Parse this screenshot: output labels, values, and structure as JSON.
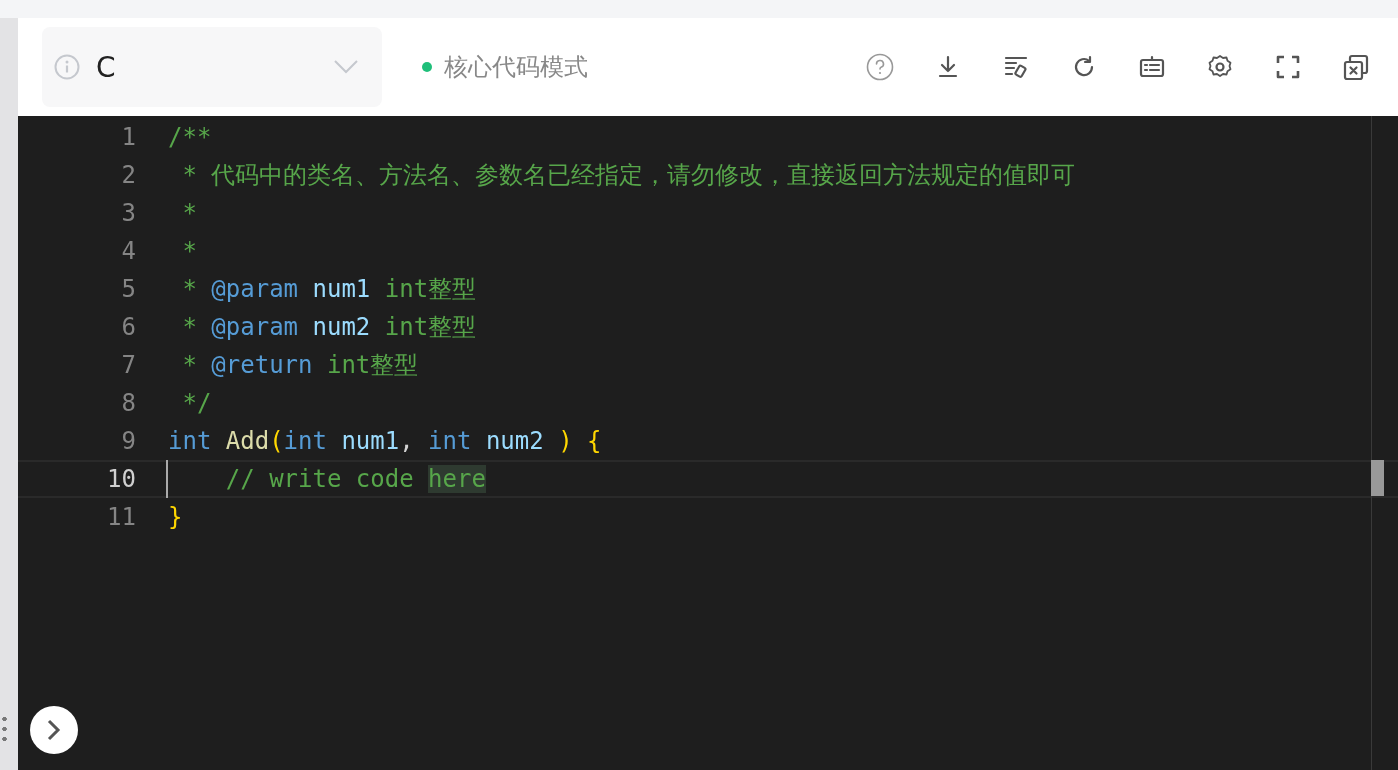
{
  "toolbar": {
    "language": {
      "value": "C"
    },
    "mode": {
      "label": "核心代码模式",
      "color": "#1fbf7a"
    }
  },
  "editor": {
    "lines": [
      {
        "number": "1",
        "current": false,
        "tokens": [
          {
            "kind": "comment",
            "text": "/**"
          }
        ]
      },
      {
        "number": "2",
        "current": false,
        "tokens": [
          {
            "kind": "comment",
            "text": " * 代码中的类名、方法名、参数名已经指定，请勿修改，直接返回方法规定的值即可"
          }
        ]
      },
      {
        "number": "3",
        "current": false,
        "tokens": [
          {
            "kind": "comment",
            "text": " *"
          }
        ]
      },
      {
        "number": "4",
        "current": false,
        "tokens": [
          {
            "kind": "comment",
            "text": " *"
          }
        ]
      },
      {
        "number": "5",
        "current": false,
        "tokens": [
          {
            "kind": "comment",
            "text": " * "
          },
          {
            "kind": "tag",
            "text": "@param "
          },
          {
            "kind": "ident",
            "text": "num1"
          },
          {
            "kind": "comment",
            "text": " int整型"
          }
        ]
      },
      {
        "number": "6",
        "current": false,
        "tokens": [
          {
            "kind": "comment",
            "text": " * "
          },
          {
            "kind": "tag",
            "text": "@param "
          },
          {
            "kind": "ident",
            "text": "num2"
          },
          {
            "kind": "comment",
            "text": " int整型"
          }
        ]
      },
      {
        "number": "7",
        "current": false,
        "tokens": [
          {
            "kind": "comment",
            "text": " * "
          },
          {
            "kind": "tag",
            "text": "@return"
          },
          {
            "kind": "comment",
            "text": " int整型"
          }
        ]
      },
      {
        "number": "8",
        "current": false,
        "tokens": [
          {
            "kind": "comment",
            "text": " */"
          }
        ]
      },
      {
        "number": "9",
        "current": false,
        "tokens": [
          {
            "kind": "keyword",
            "text": "int "
          },
          {
            "kind": "func",
            "text": "Add"
          },
          {
            "kind": "bracket",
            "text": "("
          },
          {
            "kind": "keyword",
            "text": "int "
          },
          {
            "kind": "ident",
            "text": "num1"
          },
          {
            "kind": "plain",
            "text": ", "
          },
          {
            "kind": "keyword",
            "text": "int "
          },
          {
            "kind": "ident",
            "text": "num2 "
          },
          {
            "kind": "bracket",
            "text": ") {"
          }
        ]
      },
      {
        "number": "10",
        "current": true,
        "tokens": [
          {
            "kind": "comment",
            "text": "    // write code "
          },
          {
            "kind": "highlight",
            "text": "here"
          }
        ]
      },
      {
        "number": "11",
        "current": false,
        "tokens": [
          {
            "kind": "bracket",
            "text": "}"
          }
        ]
      }
    ]
  }
}
